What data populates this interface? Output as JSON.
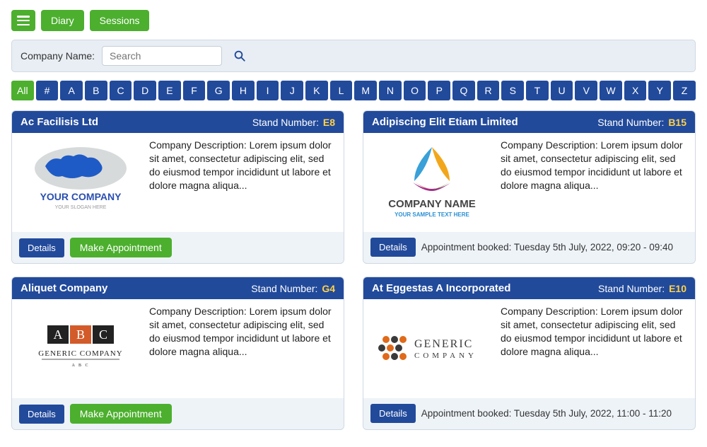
{
  "topbar": {
    "diary": "Diary",
    "sessions": "Sessions"
  },
  "search": {
    "label": "Company Name:",
    "placeholder": "Search"
  },
  "alpha": {
    "all": "All",
    "letters": [
      "#",
      "A",
      "B",
      "C",
      "D",
      "E",
      "F",
      "G",
      "H",
      "I",
      "J",
      "K",
      "L",
      "M",
      "N",
      "O",
      "P",
      "Q",
      "R",
      "S",
      "T",
      "U",
      "V",
      "W",
      "X",
      "Y",
      "Z"
    ]
  },
  "cards": [
    {
      "name": "Ac Facilisis Ltd",
      "stand_label": "Stand Number:",
      "stand": "E8",
      "desc": "Company Description: Lorem ipsum dolor sit amet, consectetur adipiscing elit, sed do eiusmod tempor incididunt ut labore et dolore magna aliqua...",
      "details": "Details",
      "action": "Make Appointment",
      "booked": ""
    },
    {
      "name": "Adipiscing Elit Etiam Limited",
      "stand_label": "Stand Number:",
      "stand": "B15",
      "desc": "Company Description: Lorem ipsum dolor sit amet, consectetur adipiscing elit, sed do eiusmod tempor incididunt ut labore et dolore magna aliqua...",
      "details": "Details",
      "action": "",
      "booked": "Appointment booked: Tuesday 5th July, 2022, 09:20 - 09:40"
    },
    {
      "name": "Aliquet Company",
      "stand_label": "Stand Number:",
      "stand": "G4",
      "desc": "Company Description: Lorem ipsum dolor sit amet, consectetur adipiscing elit, sed do eiusmod tempor incididunt ut labore et dolore magna aliqua...",
      "details": "Details",
      "action": "Make Appointment",
      "booked": ""
    },
    {
      "name": "At Eggestas A Incorporated",
      "stand_label": "Stand Number:",
      "stand": "E10",
      "desc": "Company Description: Lorem ipsum dolor sit amet, consectetur adipiscing elit, sed do eiusmod tempor incididunt ut labore et dolore magna aliqua...",
      "details": "Details",
      "action": "",
      "booked": "Appointment booked: Tuesday 5th July, 2022, 11:00 - 11:20"
    }
  ],
  "logos": {
    "0": {
      "line1": "YOUR COMPANY",
      "line2": "YOUR SLOGAN HERE"
    },
    "1": {
      "line1": "COMPANY NAME",
      "line2": "YOUR SAMPLE TEXT HERE"
    },
    "2": {
      "line1": "GENERIC COMPANY",
      "line2": "A B C"
    },
    "3": {
      "line1": "GENERIC",
      "line2": "COMPANY"
    }
  }
}
